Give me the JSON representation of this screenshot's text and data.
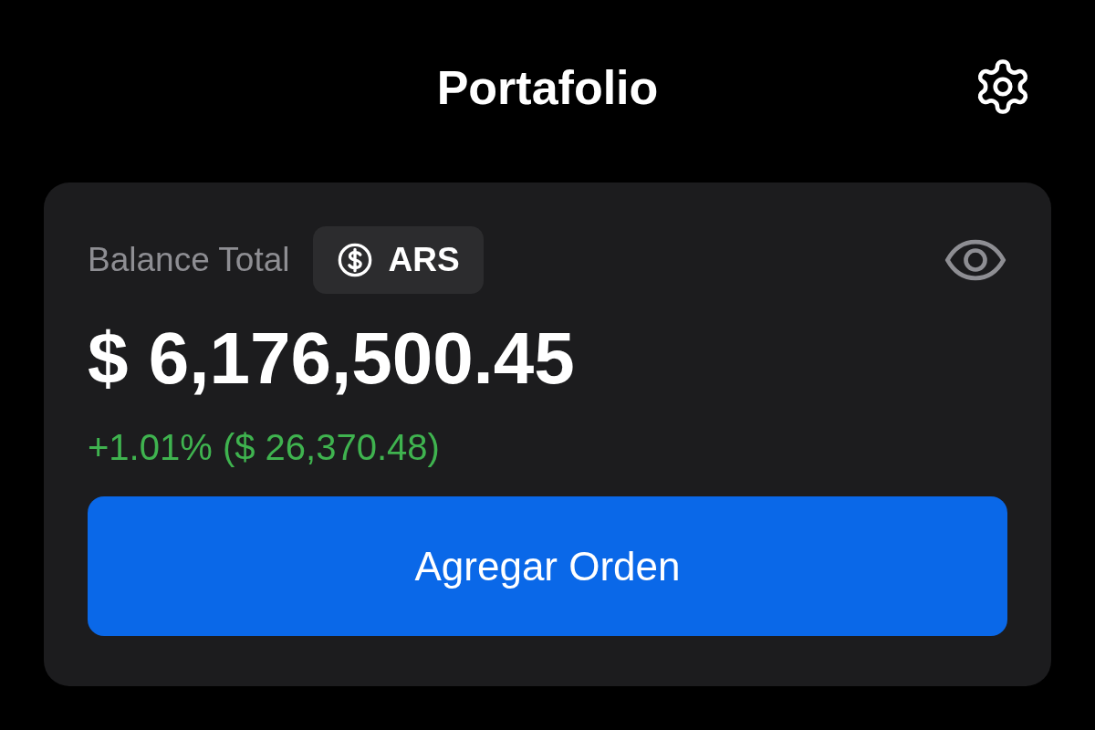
{
  "header": {
    "title": "Portafolio"
  },
  "balance": {
    "label": "Balance Total",
    "currency": "ARS",
    "amount": "$ 6,176,500.45",
    "change": "+1.01% ($ 26,370.48)"
  },
  "action": {
    "label": "Agregar Orden"
  }
}
